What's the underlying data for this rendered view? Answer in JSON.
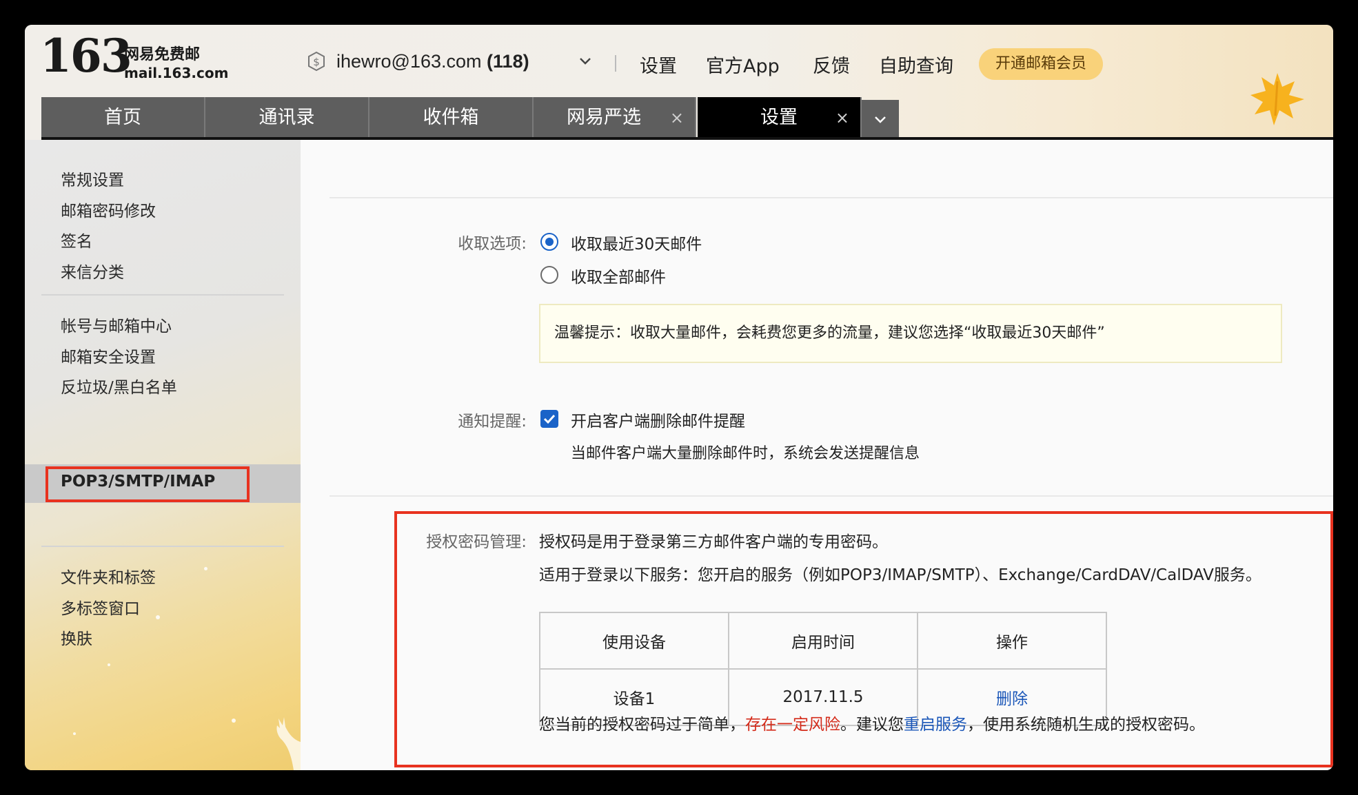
{
  "logo": {
    "number": "163",
    "name": "网易免费邮",
    "url": "mail.163.com"
  },
  "header": {
    "account_icon": "shield-dollar-icon",
    "account_email": "ihewro@163.com",
    "account_unread": "(118)",
    "links": [
      "设置",
      "官方App",
      "反馈",
      "自助查询"
    ],
    "vip_button": "开通邮箱会员"
  },
  "tabs": [
    {
      "label": "首页",
      "closable": false,
      "active": false
    },
    {
      "label": "通讯录",
      "closable": false,
      "active": false
    },
    {
      "label": "收件箱",
      "closable": false,
      "active": false
    },
    {
      "label": "网易严选",
      "closable": true,
      "active": false
    },
    {
      "label": "设置",
      "closable": true,
      "active": true
    }
  ],
  "tab_close_symbol": "×",
  "sidebar": {
    "group1": [
      "常规设置",
      "邮箱密码修改",
      "签名",
      "来信分类"
    ],
    "group2": [
      "帐号与邮箱中心",
      "邮箱安全设置",
      "反垃圾/黑白名单"
    ],
    "active": "POP3/SMTP/IMAP",
    "group3": [
      "文件夹和标签",
      "多标签窗口",
      "换肤"
    ]
  },
  "settings": {
    "receive_label": "收取选项:",
    "receive_options": [
      "收取最近30天邮件",
      "收取全部邮件"
    ],
    "receive_selected": 0,
    "tip": "温馨提示：收取大量邮件，会耗费您更多的流量，建议您选择“收取最近30天邮件”",
    "notify_label": "通知提醒:",
    "notify_checkbox": "开启客户端删除邮件提醒",
    "notify_checked": true,
    "notify_desc": "当邮件客户端大量删除邮件时，系统会发送提醒信息"
  },
  "auth": {
    "label": "授权密码管理:",
    "desc1": "授权码是用于登录第三方邮件客户端的专用密码。",
    "desc2": "适用于登录以下服务：您开启的服务（例如POP3/IMAP/SMTP）、Exchange/CardDAV/CalDAV服务。",
    "table_headers": [
      "使用设备",
      "启用时间",
      "操作"
    ],
    "rows": [
      {
        "device": "设备1",
        "date": "2017.11.5",
        "action": "删除"
      }
    ],
    "warning_pre": "您当前的授权密码过于简单，",
    "warning_risk": "存在一定风险",
    "warning_mid": "。建议您",
    "warning_link": "重启服务",
    "warning_post": "，使用系统随机生成的授权密码。"
  },
  "colors": {
    "accent_blue": "#1a63c8",
    "highlight_red": "#e8321f",
    "vip_yellow": "#f9d27a"
  }
}
